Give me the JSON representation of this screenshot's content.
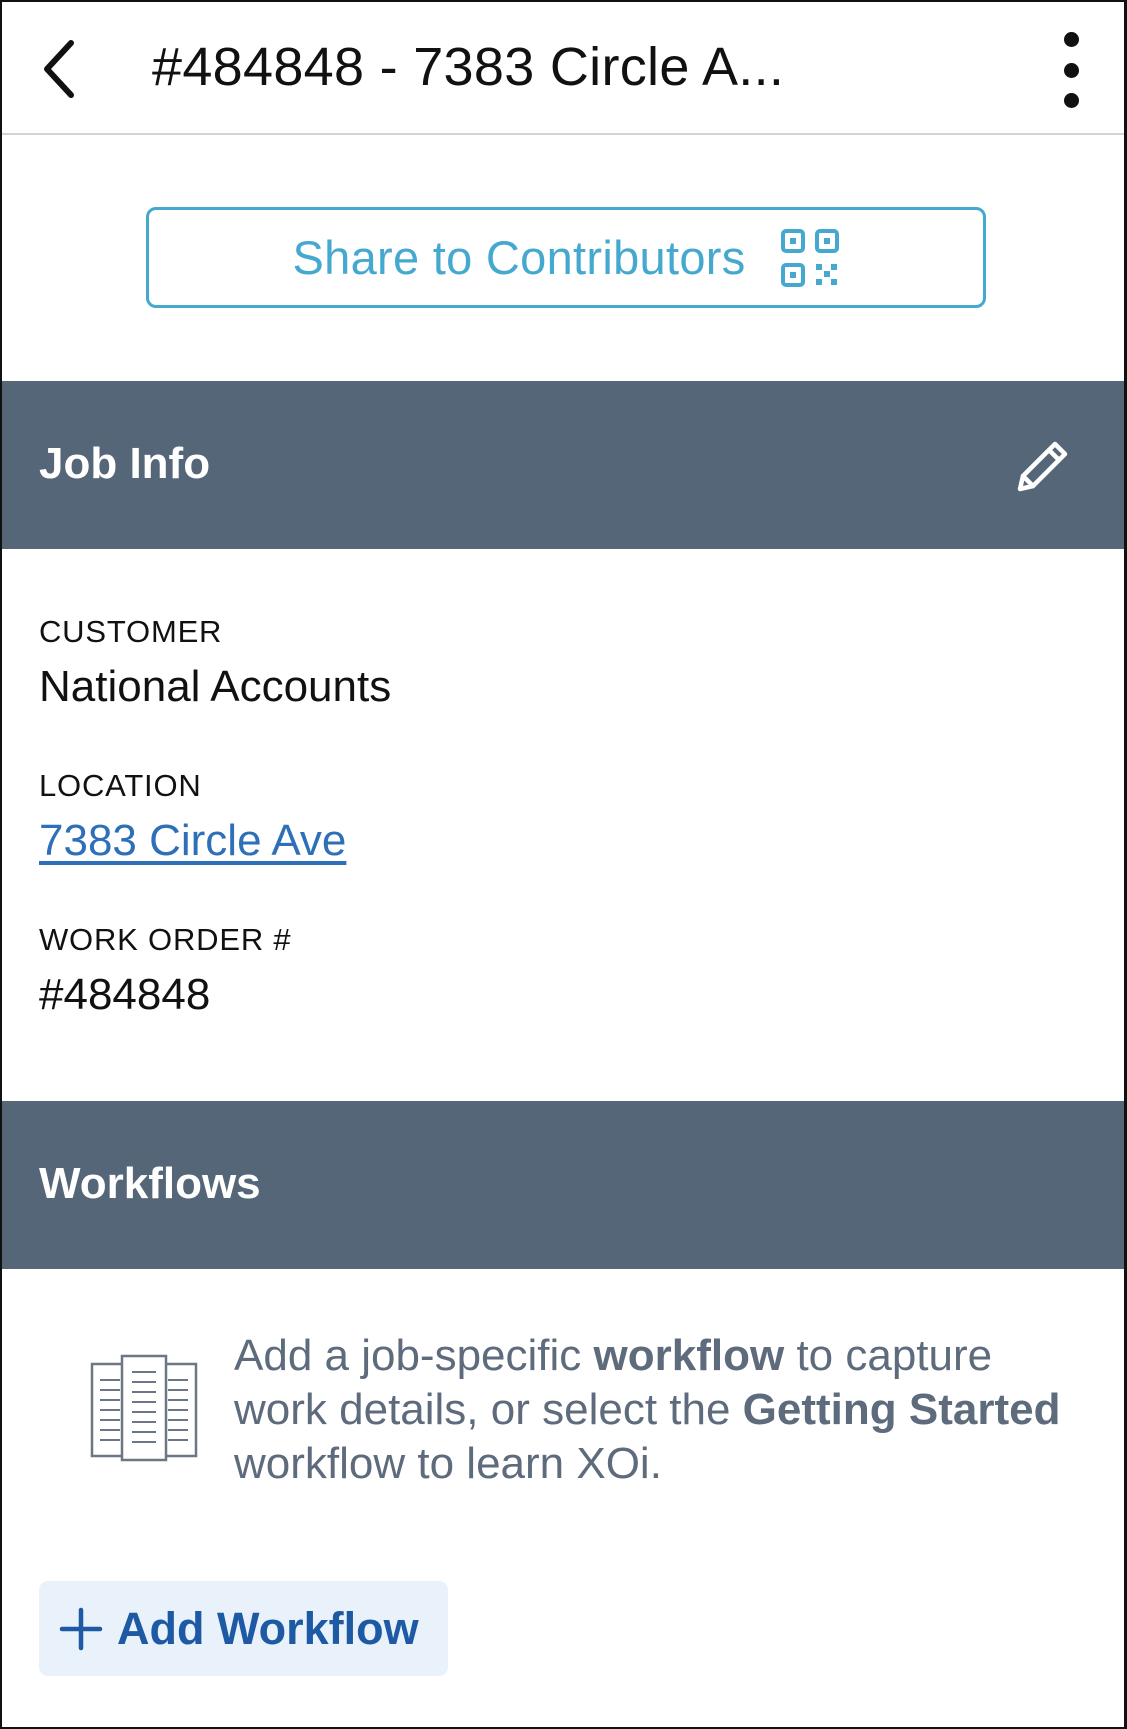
{
  "header": {
    "title": "#484848 - 7383 Circle A...",
    "back_icon": "chevron-left-icon",
    "more_icon": "more-vertical-icon"
  },
  "share": {
    "label": "Share to Contributors",
    "icon": "qr-code-icon",
    "color": "#45a8cf"
  },
  "job_info": {
    "heading": "Job Info",
    "edit_icon": "pencil-icon",
    "fields": {
      "customer_label": "CUSTOMER",
      "customer_value": "National Accounts",
      "location_label": "LOCATION",
      "location_value": "7383 Circle Ave",
      "work_order_label": "WORK ORDER #",
      "work_order_value": "#484848"
    }
  },
  "workflows": {
    "heading": "Workflows",
    "empty_icon": "document-columns-icon",
    "empty_text": {
      "part1": "Add a job-specific ",
      "bold1": "workflow",
      "part2": " to capture work details, or select the ",
      "bold2": "Getting Started",
      "part3": " workflow to learn XOi."
    },
    "add_button": {
      "label": "Add Workflow",
      "icon": "plus-icon"
    }
  },
  "colors": {
    "section_header_bg": "#566679",
    "link": "#2d6fb8",
    "add_button_bg": "#e9f1fa",
    "add_button_text": "#1d5aa3"
  }
}
